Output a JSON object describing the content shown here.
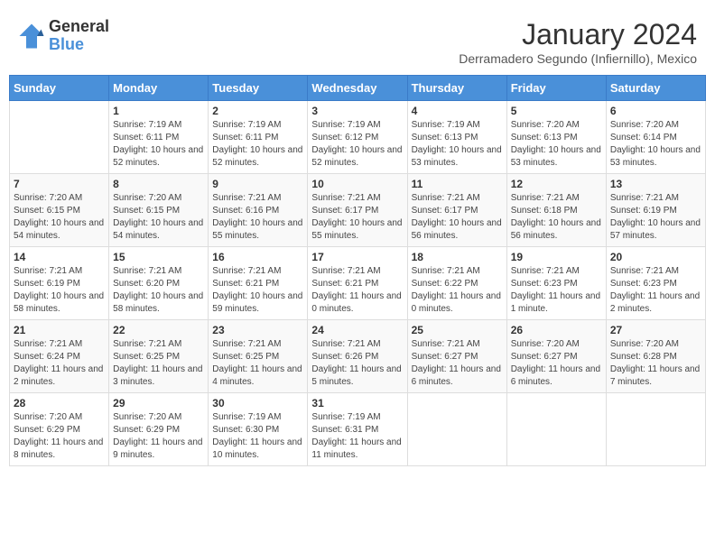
{
  "header": {
    "logo_general": "General",
    "logo_blue": "Blue",
    "month_year": "January 2024",
    "location": "Derramadero Segundo (Infiernillo), Mexico"
  },
  "days_of_week": [
    "Sunday",
    "Monday",
    "Tuesday",
    "Wednesday",
    "Thursday",
    "Friday",
    "Saturday"
  ],
  "weeks": [
    [
      {
        "day": "",
        "info": ""
      },
      {
        "day": "1",
        "info": "Sunrise: 7:19 AM\nSunset: 6:11 PM\nDaylight: 10 hours and 52 minutes."
      },
      {
        "day": "2",
        "info": "Sunrise: 7:19 AM\nSunset: 6:11 PM\nDaylight: 10 hours and 52 minutes."
      },
      {
        "day": "3",
        "info": "Sunrise: 7:19 AM\nSunset: 6:12 PM\nDaylight: 10 hours and 52 minutes."
      },
      {
        "day": "4",
        "info": "Sunrise: 7:19 AM\nSunset: 6:13 PM\nDaylight: 10 hours and 53 minutes."
      },
      {
        "day": "5",
        "info": "Sunrise: 7:20 AM\nSunset: 6:13 PM\nDaylight: 10 hours and 53 minutes."
      },
      {
        "day": "6",
        "info": "Sunrise: 7:20 AM\nSunset: 6:14 PM\nDaylight: 10 hours and 53 minutes."
      }
    ],
    [
      {
        "day": "7",
        "info": "Sunrise: 7:20 AM\nSunset: 6:15 PM\nDaylight: 10 hours and 54 minutes."
      },
      {
        "day": "8",
        "info": "Sunrise: 7:20 AM\nSunset: 6:15 PM\nDaylight: 10 hours and 54 minutes."
      },
      {
        "day": "9",
        "info": "Sunrise: 7:21 AM\nSunset: 6:16 PM\nDaylight: 10 hours and 55 minutes."
      },
      {
        "day": "10",
        "info": "Sunrise: 7:21 AM\nSunset: 6:17 PM\nDaylight: 10 hours and 55 minutes."
      },
      {
        "day": "11",
        "info": "Sunrise: 7:21 AM\nSunset: 6:17 PM\nDaylight: 10 hours and 56 minutes."
      },
      {
        "day": "12",
        "info": "Sunrise: 7:21 AM\nSunset: 6:18 PM\nDaylight: 10 hours and 56 minutes."
      },
      {
        "day": "13",
        "info": "Sunrise: 7:21 AM\nSunset: 6:19 PM\nDaylight: 10 hours and 57 minutes."
      }
    ],
    [
      {
        "day": "14",
        "info": "Sunrise: 7:21 AM\nSunset: 6:19 PM\nDaylight: 10 hours and 58 minutes."
      },
      {
        "day": "15",
        "info": "Sunrise: 7:21 AM\nSunset: 6:20 PM\nDaylight: 10 hours and 58 minutes."
      },
      {
        "day": "16",
        "info": "Sunrise: 7:21 AM\nSunset: 6:21 PM\nDaylight: 10 hours and 59 minutes."
      },
      {
        "day": "17",
        "info": "Sunrise: 7:21 AM\nSunset: 6:21 PM\nDaylight: 11 hours and 0 minutes."
      },
      {
        "day": "18",
        "info": "Sunrise: 7:21 AM\nSunset: 6:22 PM\nDaylight: 11 hours and 0 minutes."
      },
      {
        "day": "19",
        "info": "Sunrise: 7:21 AM\nSunset: 6:23 PM\nDaylight: 11 hours and 1 minute."
      },
      {
        "day": "20",
        "info": "Sunrise: 7:21 AM\nSunset: 6:23 PM\nDaylight: 11 hours and 2 minutes."
      }
    ],
    [
      {
        "day": "21",
        "info": "Sunrise: 7:21 AM\nSunset: 6:24 PM\nDaylight: 11 hours and 2 minutes."
      },
      {
        "day": "22",
        "info": "Sunrise: 7:21 AM\nSunset: 6:25 PM\nDaylight: 11 hours and 3 minutes."
      },
      {
        "day": "23",
        "info": "Sunrise: 7:21 AM\nSunset: 6:25 PM\nDaylight: 11 hours and 4 minutes."
      },
      {
        "day": "24",
        "info": "Sunrise: 7:21 AM\nSunset: 6:26 PM\nDaylight: 11 hours and 5 minutes."
      },
      {
        "day": "25",
        "info": "Sunrise: 7:21 AM\nSunset: 6:27 PM\nDaylight: 11 hours and 6 minutes."
      },
      {
        "day": "26",
        "info": "Sunrise: 7:20 AM\nSunset: 6:27 PM\nDaylight: 11 hours and 6 minutes."
      },
      {
        "day": "27",
        "info": "Sunrise: 7:20 AM\nSunset: 6:28 PM\nDaylight: 11 hours and 7 minutes."
      }
    ],
    [
      {
        "day": "28",
        "info": "Sunrise: 7:20 AM\nSunset: 6:29 PM\nDaylight: 11 hours and 8 minutes."
      },
      {
        "day": "29",
        "info": "Sunrise: 7:20 AM\nSunset: 6:29 PM\nDaylight: 11 hours and 9 minutes."
      },
      {
        "day": "30",
        "info": "Sunrise: 7:19 AM\nSunset: 6:30 PM\nDaylight: 11 hours and 10 minutes."
      },
      {
        "day": "31",
        "info": "Sunrise: 7:19 AM\nSunset: 6:31 PM\nDaylight: 11 hours and 11 minutes."
      },
      {
        "day": "",
        "info": ""
      },
      {
        "day": "",
        "info": ""
      },
      {
        "day": "",
        "info": ""
      }
    ]
  ]
}
